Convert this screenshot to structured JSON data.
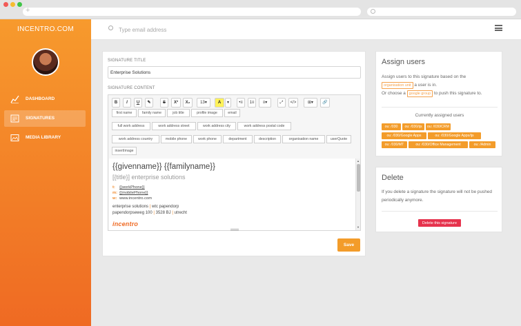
{
  "browser": {
    "new_tab": "+"
  },
  "sidebar": {
    "brand": "INCENTRO.COM",
    "items": [
      {
        "label": "DASHBOARD",
        "icon": "chart-line-icon"
      },
      {
        "label": "SIGNATURES",
        "icon": "signature-document-icon"
      },
      {
        "label": "MEDIA LIBRARY",
        "icon": "image-icon"
      }
    ]
  },
  "topbar": {
    "search_placeholder": "Type email address"
  },
  "form": {
    "title_label": "SIGNATURE TITLE",
    "title_value": "Enterprise Solutions",
    "content_label": "SIGNATURE CONTENT",
    "font_size": "13",
    "toolbar": [
      "B",
      "I",
      "U",
      "✎",
      "S",
      "X²",
      "X₂",
      "13▾",
      "A",
      "▾",
      "•≡",
      "1≡",
      "≡▾",
      "⤢",
      "</>",
      "⊞▾",
      "🔗"
    ],
    "tags": [
      [
        "first name",
        "family name",
        "job title",
        "profile image",
        "email"
      ],
      [
        "full work address",
        "work address street",
        "work address city",
        "work address postal code"
      ],
      [
        "work address country",
        "mobile phone",
        "work phone",
        "department",
        "description",
        "organisation name",
        "userQuote"
      ],
      [
        "insertImage"
      ]
    ],
    "save": "Save"
  },
  "signature": {
    "name": "{{givenname}} {{familyname}}",
    "title": "[{title}] enterprise solutions",
    "lines": [
      {
        "key": "t:",
        "value": "{{workPhone}}"
      },
      {
        "key": "m:",
        "value": "{{mobilePhone}}"
      },
      {
        "key": "w:",
        "value": "www.incentro.com"
      }
    ],
    "address1": [
      "enterprise solutions",
      "wtc papendorp"
    ],
    "address2": [
      "papendorpseweg 100",
      "3528 BJ",
      "utrecht"
    ],
    "logo": "incentro"
  },
  "assign": {
    "heading": "Assign users",
    "text1_before": "Assign users to this signature based on the",
    "chip_ou": "organisation unit",
    "text1_after": "a user is in.",
    "text2_before": "Or choose a",
    "chip_group": "google group",
    "text2_after": "to push this signature to.",
    "current_label": "Currently assigned users",
    "ous": [
      "ou: /030",
      "ou: /030/ijs",
      "ou: /030/CRM",
      "ou: /030/Google Apps",
      "ou: /030/Google Apps/ijs",
      "ou: /030/MT",
      "ou: /030/Office Management",
      "ou: /Admin"
    ]
  },
  "delete": {
    "heading": "Delete",
    "text": "If you delete a signature the signature will not be pushed periodically anymore.",
    "button": "Delete this signature"
  },
  "colors": {
    "accent": "#f39c2a",
    "sidebar_top": "#f79a2d",
    "sidebar_bottom": "#ef6a23",
    "danger": "#e6334d"
  }
}
